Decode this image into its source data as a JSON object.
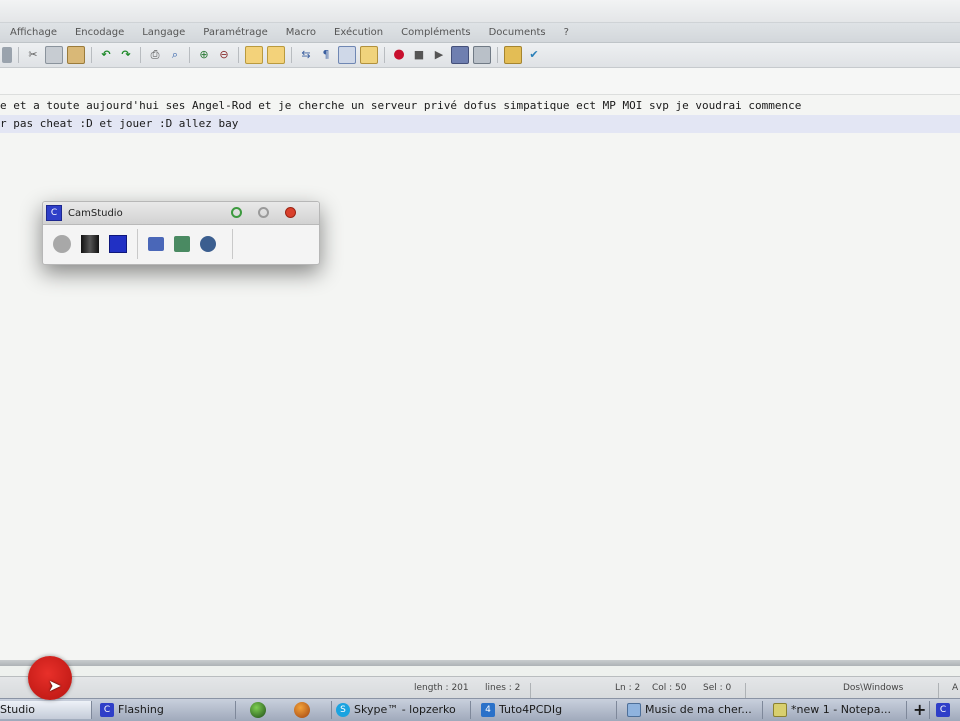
{
  "menu": [
    "Affichage",
    "Encodage",
    "Langage",
    "Paramétrage",
    "Macro",
    "Exécution",
    "Compléments",
    "Documents",
    "?"
  ],
  "toolbar_icons": [
    "paste-icon",
    "cut-icon",
    "copy-icon",
    "clipboard-icon",
    "undo-icon",
    "redo-icon",
    "print-icon",
    "find-icon",
    "zoom-in-icon",
    "zoom-out-icon",
    "sync-v-icon",
    "sync-h-icon",
    "wrap-icon",
    "pilcrow-icon",
    "indent-guide-icon",
    "doc-map-icon",
    "record-icon",
    "stop-icon",
    "play-icon",
    "play-multi-icon",
    "save-macro-icon",
    "folder-icon",
    "spellcheck-icon"
  ],
  "editor": {
    "line1": "e et a toute aujourd'hui ses Angel-Rod et je cherche un serveur privé dofus simpatique ect MP MOI svp je voudrai commence",
    "line2": "r pas cheat :D et jouer :D allez bay"
  },
  "camstudio": {
    "title": "CamStudio",
    "buttons": [
      "record-button",
      "pause-button",
      "stop-button",
      "screen-annotation-button",
      "video-annotation-button",
      "webcam-button"
    ]
  },
  "status": {
    "length": "length : 201",
    "lines": "lines : 2",
    "ln": "Ln : 2",
    "col": "Col : 50",
    "sel": "Sel : 0",
    "eol": "Dos\\Windows",
    "extra": "A"
  },
  "taskbar": {
    "items": [
      {
        "label": "Studio"
      },
      {
        "label": "Flashing"
      },
      {
        "label": "Skype™ - lopzerko"
      },
      {
        "label": "Tuto4PCDIg"
      },
      {
        "label": "Music de ma cher..."
      },
      {
        "label": "*new 1 - Notepa..."
      }
    ],
    "plus": "+"
  },
  "colors": {
    "accent": "#2f3fc8",
    "record": "#c8102e",
    "cursor_dot": "#d3221b"
  }
}
